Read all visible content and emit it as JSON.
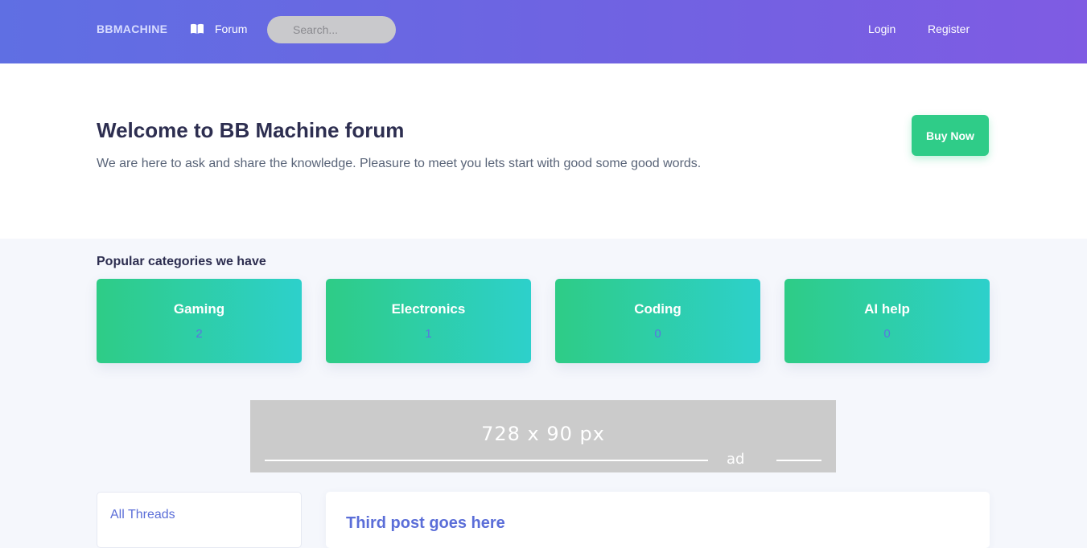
{
  "nav": {
    "brand": "BBMACHINE",
    "forum_label": "Forum",
    "forum_icon": "book-icon",
    "search_placeholder": "Search...",
    "login_label": "Login",
    "register_label": "Register"
  },
  "hero": {
    "title": "Welcome to BB Machine forum",
    "subtitle": "We are here to ask and share the knowledge. Pleasure to meet you lets start with good some good words.",
    "buy_label": "Buy Now"
  },
  "categories": {
    "heading": "Popular categories we have",
    "items": [
      {
        "name": "Gaming",
        "count": "2"
      },
      {
        "name": "Electronics",
        "count": "1"
      },
      {
        "name": "Coding",
        "count": "0"
      },
      {
        "name": "AI help",
        "count": "0"
      }
    ]
  },
  "ad": {
    "size_text": "728 x 90 px",
    "label": "ad"
  },
  "sidebar": {
    "all_threads_label": "All Threads"
  },
  "post": {
    "title": "Third post goes here"
  },
  "colors": {
    "nav_gradient_start": "#5f6fe3",
    "nav_gradient_end": "#7f5be3",
    "accent_green": "#2fcc88",
    "card_gradient_end": "#2dd0cb",
    "link_blue": "#5b6ed8"
  }
}
